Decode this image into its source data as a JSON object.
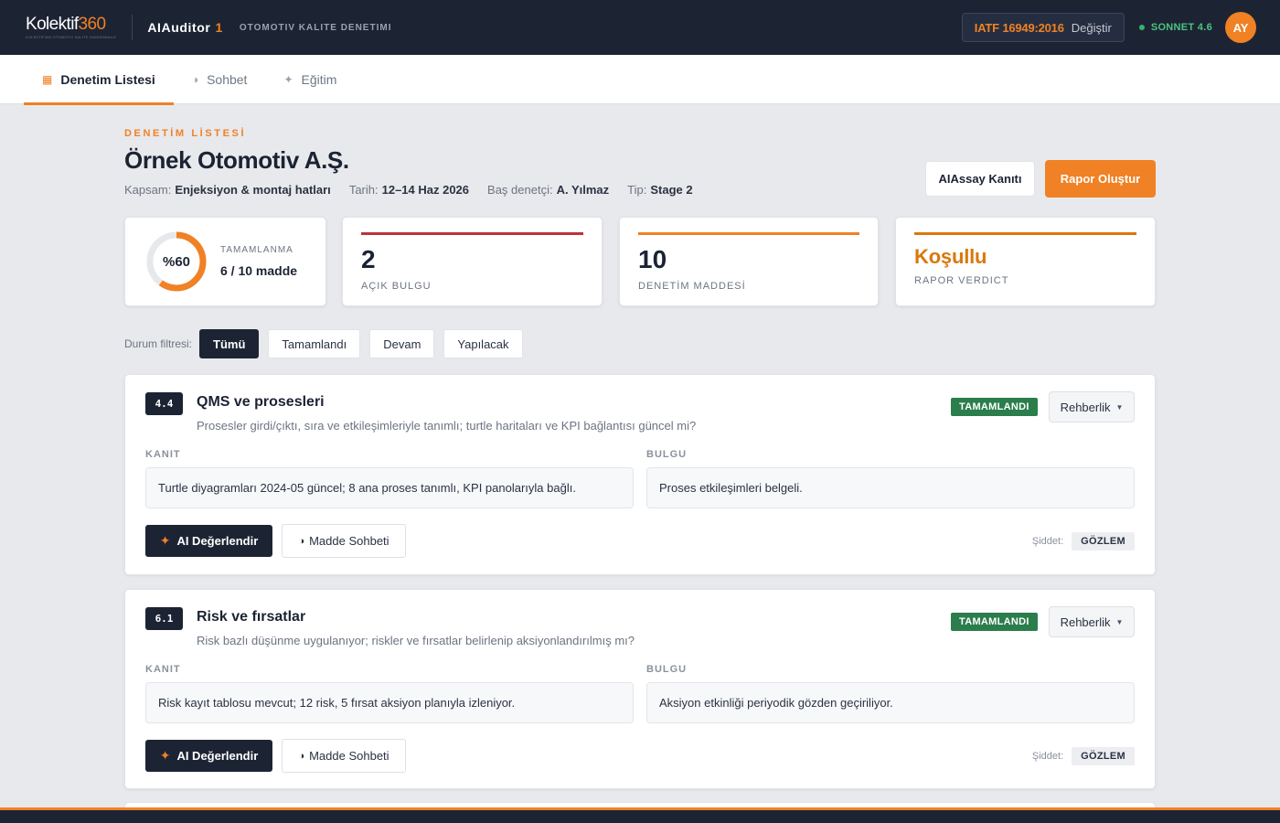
{
  "brand": {
    "logo_text": "Kolektif",
    "logo_num": "360",
    "logo_tagline": "KOLEKTIF360 OTOMOTIV KALITE DANISMANLIK",
    "app_name": "AIAuditor",
    "app_version": "1",
    "app_subtitle": "OTOMOTIV KALITE DENETIMI"
  },
  "header_right": {
    "standard": "IATF 16949:2016",
    "change_label": "Değiştir",
    "model_label": "SONNET 4.6",
    "avatar_initials": "AY"
  },
  "tabs": [
    {
      "label": "Denetim Listesi",
      "icon": "grid-icon",
      "active": true
    },
    {
      "label": "Sohbet",
      "icon": "half-circle-icon",
      "active": false
    },
    {
      "label": "Eğitim",
      "icon": "sparkle-icon",
      "active": false
    }
  ],
  "page": {
    "eyebrow": "DENETİM LİSTESİ",
    "title": "Örnek Otomotiv A.Ş.",
    "meta": {
      "scope_label": "Kapsam:",
      "scope_value": "Enjeksiyon & montaj hatları",
      "date_label": "Tarih:",
      "date_value": "12–14 Haz 2026",
      "lead_label": "Baş denetçi:",
      "lead_value": "A. Yılmaz",
      "type_label": "Tip:",
      "type_value": "Stage 2"
    },
    "evidence_button": "AIAssay Kanıtı",
    "report_button": "Rapor Oluştur"
  },
  "stats": {
    "progress": {
      "percent_label": "%60",
      "fraction": 0.6,
      "caption": "TAMAMLANMA",
      "value": "6 / 10 madde"
    },
    "open_findings": {
      "value": "2",
      "caption": "AÇIK BULGU",
      "accent": "#c0313b"
    },
    "audit_items": {
      "value": "10",
      "caption": "DENETİM MADDESİ",
      "accent": "#f08124"
    },
    "verdict": {
      "value": "Koşullu",
      "caption": "RAPOR VERDICT",
      "accent": "#d9780d"
    }
  },
  "filters": {
    "label": "Durum filtresi:",
    "options": [
      "Tümü",
      "Tamamlandı",
      "Devam",
      "Yapılacak"
    ],
    "selected": "Tümü"
  },
  "item_labels": {
    "evidence": "KANIT",
    "finding": "BULGU",
    "ai_button": "AI Değerlendir",
    "chat_button": "Madde Sohbeti",
    "guide_button": "Rehberlik",
    "severity_label": "Şiddet:"
  },
  "items": [
    {
      "code": "4.4",
      "title": "QMS ve prosesleri",
      "question": "Prosesler girdi/çıktı, sıra ve etkileşimleriyle tanımlı; turtle haritaları ve KPI bağlantısı güncel mi?",
      "status": "TAMAMLANDI",
      "evidence": "Turtle diyagramları 2024-05 güncel; 8 ana proses tanımlı, KPI panolarıyla bağlı.",
      "finding": "Proses etkileşimleri belgeli.",
      "severity": "GÖZLEM"
    },
    {
      "code": "6.1",
      "title": "Risk ve fırsatlar",
      "question": "Risk bazlı düşünme uygulanıyor; riskler ve fırsatlar belirlenip aksiyonlandırılmış mı?",
      "status": "TAMAMLANDI",
      "evidence": "Risk kayıt tablosu mevcut; 12 risk, 5 fırsat aksiyon planıyla izleniyor.",
      "finding": "Aksiyon etkinliği periyodik gözden geçiriliyor.",
      "severity": "GÖZLEM"
    }
  ]
}
